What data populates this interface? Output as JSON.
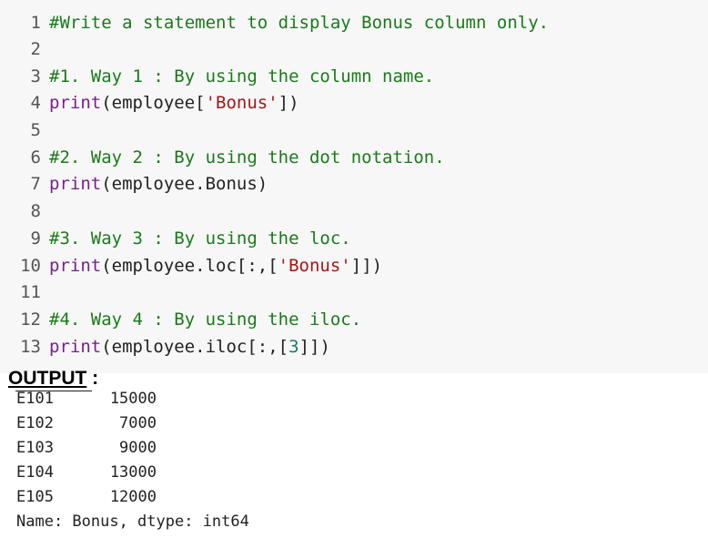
{
  "code": {
    "lines": [
      {
        "num": "1",
        "parts": [
          {
            "t": "#Write a statement to display Bonus column only.",
            "c": "comment"
          }
        ]
      },
      {
        "num": "2",
        "parts": []
      },
      {
        "num": "3",
        "parts": [
          {
            "t": "#1. Way 1 : By using the column name.",
            "c": "comment"
          }
        ]
      },
      {
        "num": "4",
        "parts": [
          {
            "t": "print",
            "c": "kw"
          },
          {
            "t": "(employee[",
            "c": "plain"
          },
          {
            "t": "'Bonus'",
            "c": "str"
          },
          {
            "t": "])",
            "c": "plain"
          }
        ]
      },
      {
        "num": "5",
        "parts": []
      },
      {
        "num": "6",
        "parts": [
          {
            "t": "#2. Way 2 : By using the dot notation.",
            "c": "comment"
          }
        ]
      },
      {
        "num": "7",
        "parts": [
          {
            "t": "print",
            "c": "kw"
          },
          {
            "t": "(employee.Bonus)",
            "c": "plain"
          }
        ]
      },
      {
        "num": "8",
        "parts": []
      },
      {
        "num": "9",
        "parts": [
          {
            "t": "#3. Way 3 : By using the loc.",
            "c": "comment"
          }
        ]
      },
      {
        "num": "10",
        "parts": [
          {
            "t": "print",
            "c": "kw"
          },
          {
            "t": "(employee.loc[:,[",
            "c": "plain"
          },
          {
            "t": "'Bonus'",
            "c": "str"
          },
          {
            "t": "]])",
            "c": "plain"
          }
        ]
      },
      {
        "num": "11",
        "parts": []
      },
      {
        "num": "12",
        "parts": [
          {
            "t": "#4. Way 4 : By using the iloc.",
            "c": "comment"
          }
        ]
      },
      {
        "num": "13",
        "parts": [
          {
            "t": "print",
            "c": "kw"
          },
          {
            "t": "(employee.iloc[:,[",
            "c": "plain"
          },
          {
            "t": "3",
            "c": "num"
          },
          {
            "t": "]])",
            "c": "plain"
          }
        ]
      }
    ]
  },
  "output": {
    "heading": "OUTPUT",
    "heading_suffix": " :",
    "rows": [
      {
        "index": "E101",
        "value": "15000"
      },
      {
        "index": "E102",
        "value": "7000"
      },
      {
        "index": "E103",
        "value": "9000"
      },
      {
        "index": "E104",
        "value": "13000"
      },
      {
        "index": "E105",
        "value": "12000"
      }
    ],
    "footer": "Name: Bonus, dtype: int64"
  }
}
